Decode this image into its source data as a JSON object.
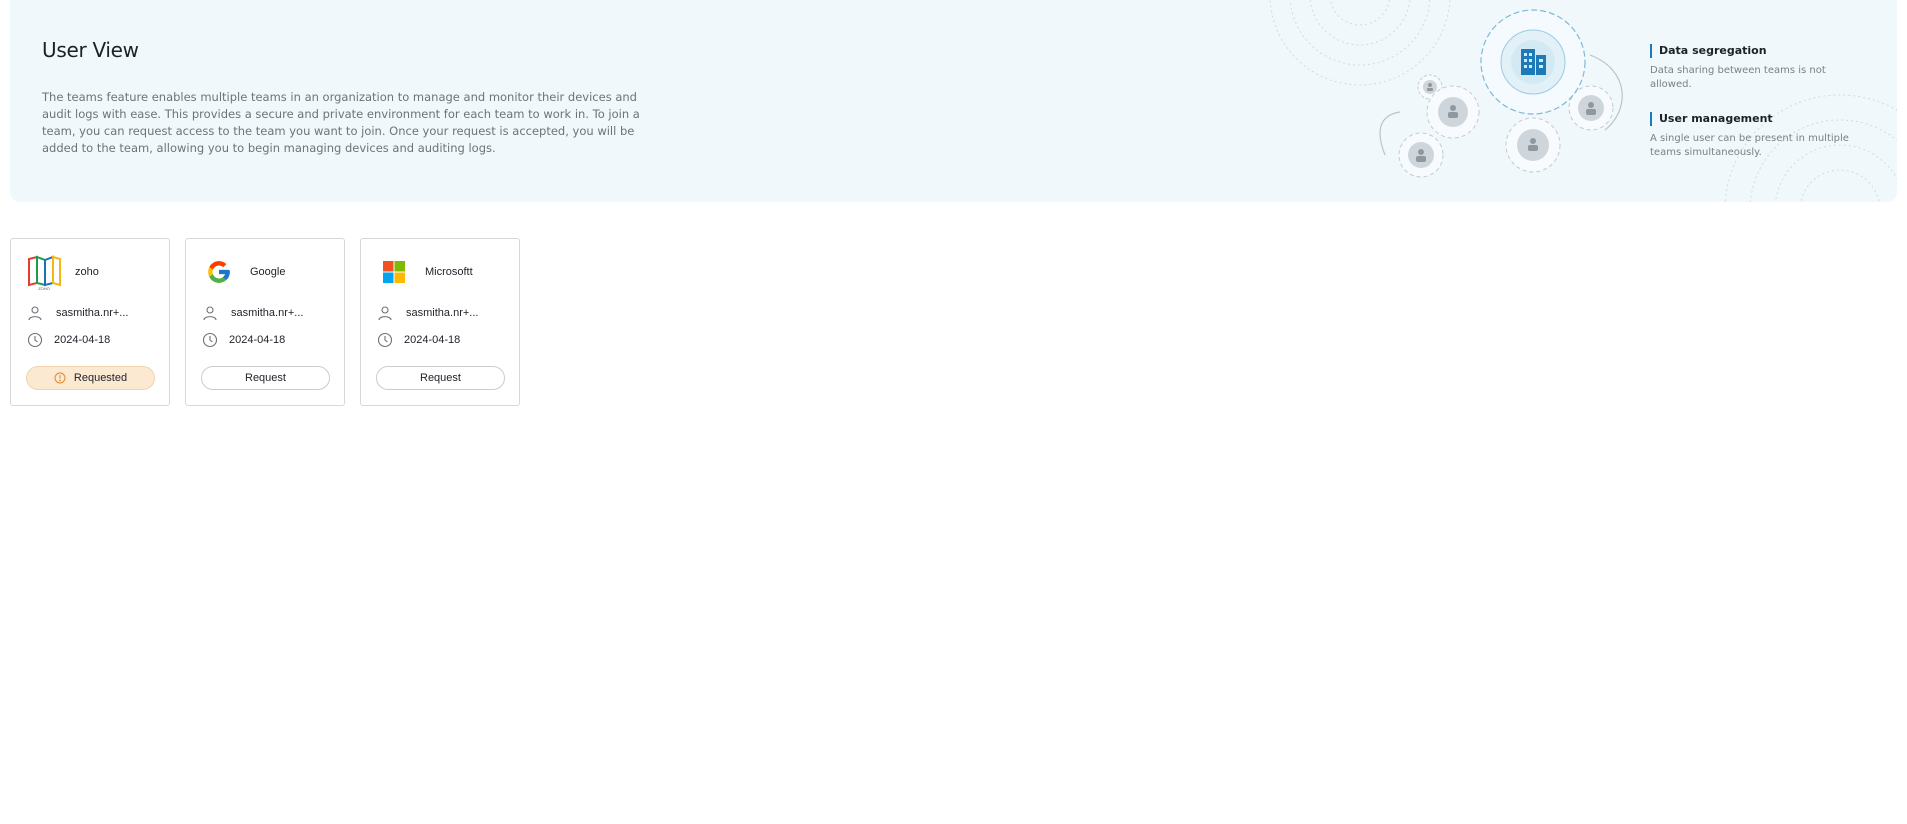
{
  "banner": {
    "title": "User View",
    "description": "The teams feature enables multiple teams in an organization to manage and monitor their devices and audit logs with ease. This provides a secure and private environment for each team to work in. To join a team, you can request access to the team you want to join. Once your request is accepted, you will be added to the team, allowing you to begin managing devices and auditing logs.",
    "features": [
      {
        "title": "Data segregation",
        "description": "Data sharing between teams is not allowed."
      },
      {
        "title": "User management",
        "description": "A single user can be present in multiple teams simultaneously."
      }
    ]
  },
  "teams": [
    {
      "name": "zoho",
      "logo": "zoho-logo",
      "user": "sasmitha.nr+...",
      "date": "2024-04-18",
      "action": "Requested",
      "status": "requested"
    },
    {
      "name": "Google",
      "logo": "google-logo",
      "user": "sasmitha.nr+...",
      "date": "2024-04-18",
      "action": "Request",
      "status": "none"
    },
    {
      "name": "Microsoftt",
      "logo": "microsoft-logo",
      "user": "sasmitha.nr+...",
      "date": "2024-04-18",
      "action": "Request",
      "status": "none"
    }
  ],
  "colors": {
    "banner_bg": "#f0f8fc",
    "accent": "#1d79b8",
    "requested_bg": "#fbe9d2",
    "warning": "#e0892a"
  }
}
